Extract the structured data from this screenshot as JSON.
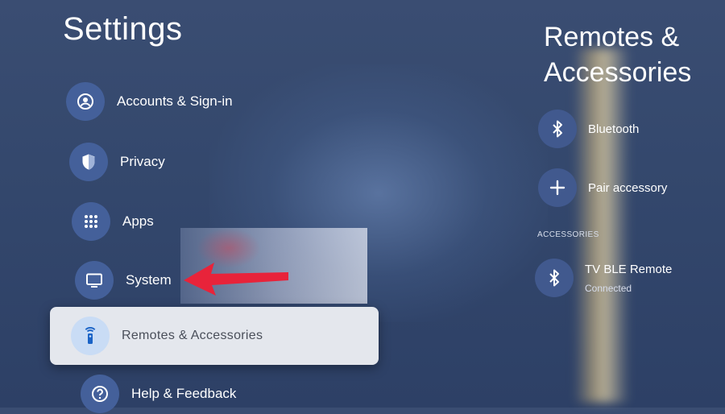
{
  "left_panel": {
    "title": "Settings",
    "items": [
      {
        "label": "Accounts & Sign-in",
        "icon": "account-circle-icon"
      },
      {
        "label": "Privacy",
        "icon": "shield-icon"
      },
      {
        "label": "Apps",
        "icon": "apps-grid-icon"
      },
      {
        "label": "System",
        "icon": "tv-monitor-icon"
      },
      {
        "label": "Remotes & Accessories",
        "icon": "remote-control-icon",
        "selected": true
      },
      {
        "label": "Help & Feedback",
        "icon": "help-icon"
      }
    ]
  },
  "right_panel": {
    "title_line1": "Remotes &",
    "title_line2": "Accessories",
    "actions": [
      {
        "label": "Bluetooth",
        "icon": "bluetooth-icon"
      },
      {
        "label": "Pair accessory",
        "icon": "plus-icon"
      }
    ],
    "section_header": "ACCESSORIES",
    "devices": [
      {
        "name": "TV BLE Remote",
        "status": "Connected",
        "icon": "bluetooth-icon"
      }
    ]
  },
  "colors": {
    "background": "#34486d",
    "icon_circle": "#44609a",
    "selected_bg": "#e4e7ed",
    "selected_icon_bg": "#c9dcf5",
    "arrow": "#e8233a"
  }
}
